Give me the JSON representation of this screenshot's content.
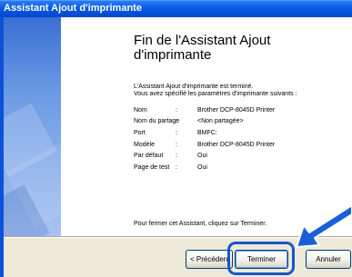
{
  "window": {
    "title": "Assistant Ajout d'imprimante"
  },
  "icons": {
    "wizard": "printer-check-icon",
    "arrow": "pointing-arrow-icon"
  },
  "heading": {
    "line1": "Fin de l'Assistant Ajout",
    "line2": "d'imprimante"
  },
  "intro": {
    "line1": "L'Assistant Ajout d'imprimante est terminé.",
    "line2": "Vous avez spécifié les paramètres d'imprimante suivants :"
  },
  "settings": [
    {
      "label": "Nom",
      "sep": ":",
      "value": "Brother DCP-8045D Printer"
    },
    {
      "label": "Nom du partage",
      "sep": ":",
      "value": "<Non partagée>"
    },
    {
      "label": "Port",
      "sep": ":",
      "value": "BMFC:"
    },
    {
      "label": "Modèle",
      "sep": ":",
      "value": "Brother DCP-8045D Printer"
    },
    {
      "label": "Par défaut",
      "sep": ":",
      "value": "Oui"
    },
    {
      "label": "Page de test",
      "sep": ":",
      "value": "Oui"
    }
  ],
  "footer": {
    "text": "Pour fermer cet Assistant, cliquez sur Terminer."
  },
  "buttons": {
    "back": "< Précédent",
    "finish": "Terminer",
    "cancel": "Annuler"
  },
  "colors": {
    "titlebar": "#0a5ae0",
    "highlight": "#1a55c8",
    "arrow": "#1a5fd8"
  }
}
